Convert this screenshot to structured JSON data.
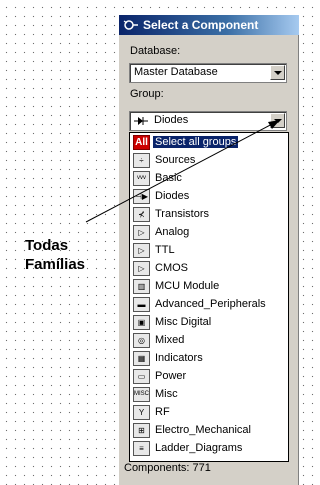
{
  "annotation": {
    "line1": "Todas",
    "line2": "Famílias"
  },
  "window": {
    "title": "Select a Component",
    "database_label": "Database:",
    "database_value": "Master Database",
    "group_label": "Group:",
    "group_value": "Diodes",
    "status": "Components: 771"
  },
  "groups": [
    {
      "label": "Select all groups",
      "icon": "all-groups-icon",
      "selected": true
    },
    {
      "label": "Sources",
      "icon": "sources-icon"
    },
    {
      "label": "Basic",
      "icon": "basic-icon"
    },
    {
      "label": "Diodes",
      "icon": "diodes-icon"
    },
    {
      "label": "Transistors",
      "icon": "transistors-icon"
    },
    {
      "label": "Analog",
      "icon": "analog-icon"
    },
    {
      "label": "TTL",
      "icon": "ttl-icon"
    },
    {
      "label": "CMOS",
      "icon": "cmos-icon"
    },
    {
      "label": "MCU Module",
      "icon": "mcu-module-icon"
    },
    {
      "label": "Advanced_Peripherals",
      "icon": "advanced-peripherals-icon"
    },
    {
      "label": "Misc Digital",
      "icon": "misc-digital-icon"
    },
    {
      "label": "Mixed",
      "icon": "mixed-icon"
    },
    {
      "label": "Indicators",
      "icon": "indicators-icon"
    },
    {
      "label": "Power",
      "icon": "power-icon"
    },
    {
      "label": "Misc",
      "icon": "misc-icon"
    },
    {
      "label": "RF",
      "icon": "rf-icon"
    },
    {
      "label": "Electro_Mechanical",
      "icon": "electro-mechanical-icon"
    },
    {
      "label": "Ladder_Diagrams",
      "icon": "ladder-diagrams-icon"
    }
  ]
}
